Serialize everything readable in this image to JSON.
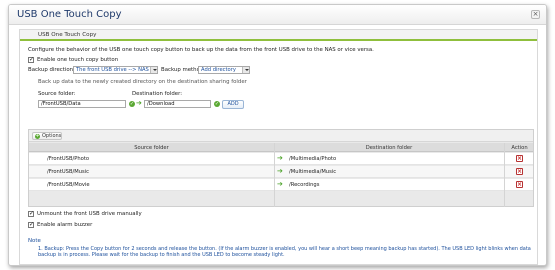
{
  "window": {
    "title": "USB One Touch Copy",
    "close_glyph": "×"
  },
  "section": {
    "title": "USB One Touch Copy"
  },
  "description": "Configure the behavior of the USB one touch copy button to back up the data from the front USB drive to the NAS or vice versa.",
  "enable_button": {
    "label": "Enable one touch copy button",
    "checked": true
  },
  "backup_direction": {
    "label": "Backup direction :",
    "value": "The front USB drive --> NAS"
  },
  "backup_method": {
    "label": "Backup method:",
    "value": "Add directory"
  },
  "backup_info": "Back up data to the newly created directory on the destination sharing folder",
  "source_folder": {
    "label": "Source folder:",
    "value": "/FrontUSB/Data"
  },
  "destination_folder": {
    "label": "Destination folder:",
    "value": "/Download"
  },
  "add_button": "ADD",
  "options_button": "Options",
  "table": {
    "headers": {
      "source": "Source folder",
      "destination": "Destination folder",
      "action": "Action"
    },
    "rows": [
      {
        "source": "/FrontUSB/Photo",
        "destination": "/Multimedia/Photo"
      },
      {
        "source": "/FrontUSB/Music",
        "destination": "/Multimedia/Music"
      },
      {
        "source": "/FrontUSB/Movie",
        "destination": "/Recordings"
      }
    ]
  },
  "unmount": {
    "label": "Unmount the front USB drive manually",
    "checked": true
  },
  "alarm": {
    "label": "Enable alarm buzzer",
    "checked": true
  },
  "note": {
    "title": "Note",
    "text": "1. Backup: Press the Copy button for 2 seconds and release the button. (If the alarm buzzer is enabled, you will hear a short beep meaning backup has started). The USB LED light blinks when data backup is in process. Please wait for the backup to finish and the USB LED to become steady light."
  },
  "colors": {
    "accent_green": "#8fbf3c",
    "link_blue": "#1b4e9b",
    "title_blue": "#1f3a6b"
  }
}
